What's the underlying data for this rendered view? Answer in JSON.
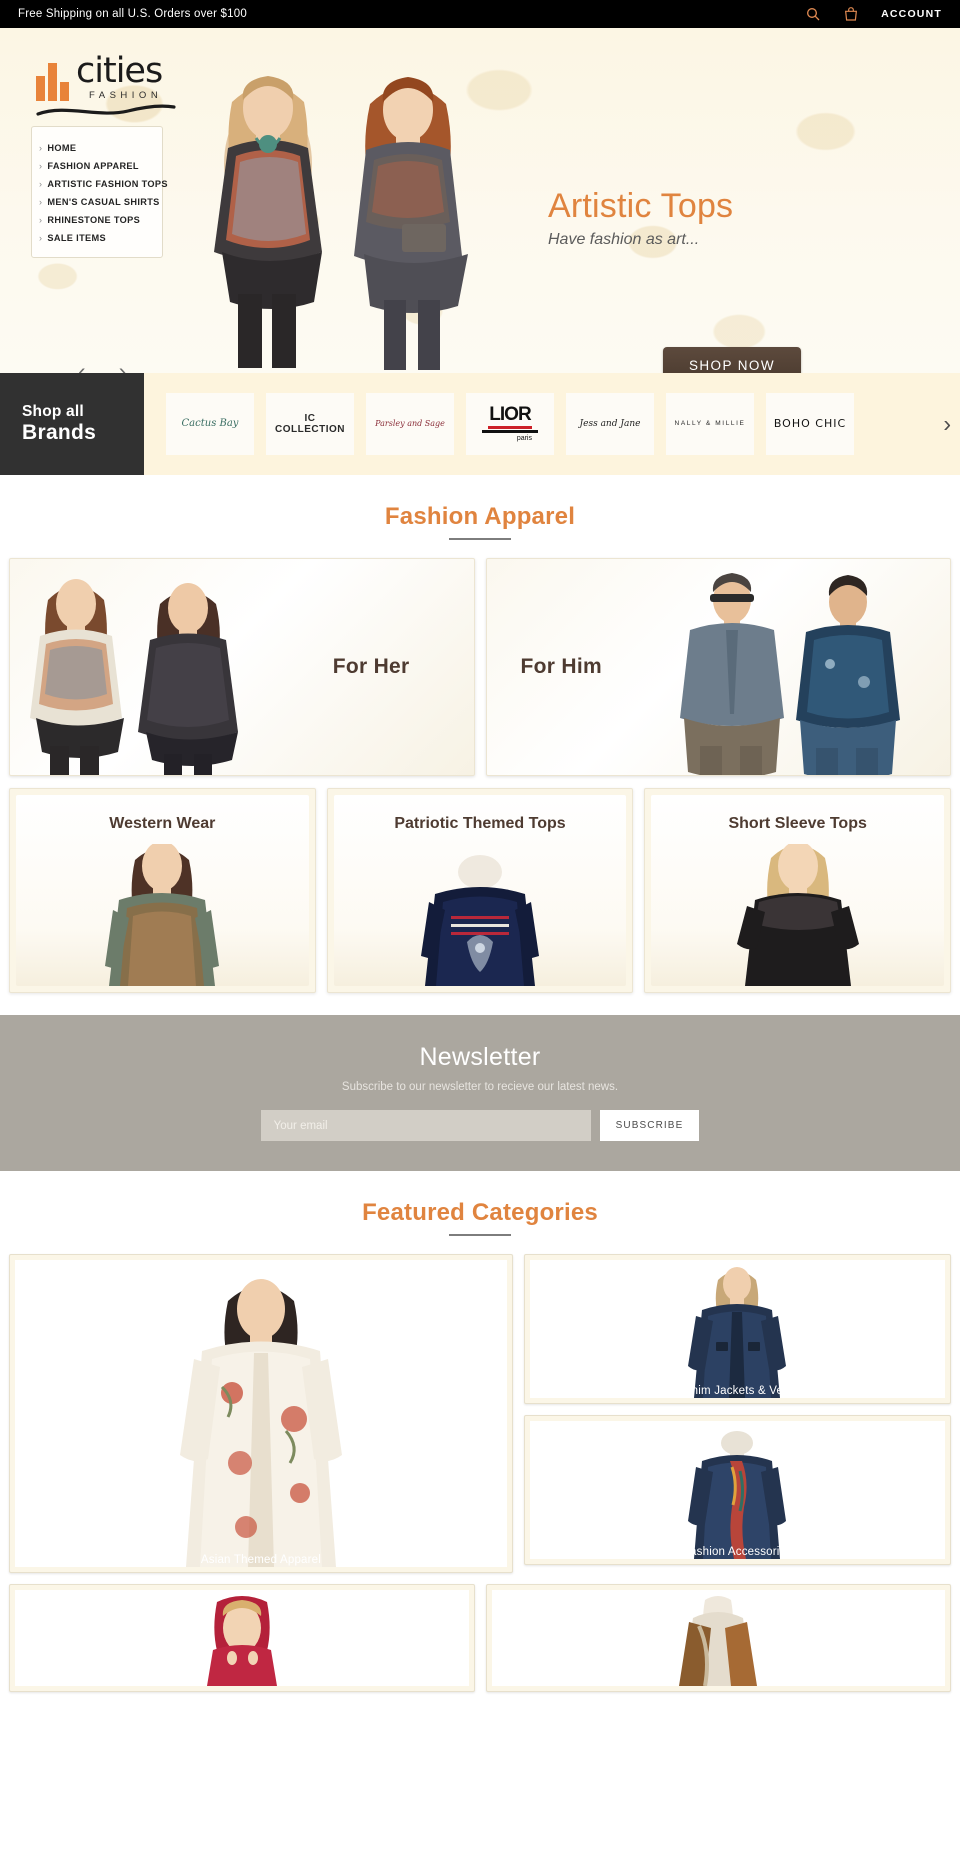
{
  "topbar": {
    "message": "Free Shipping on all U.S. Orders over $100",
    "search_icon": "search-icon",
    "bag_icon": "shopping-bag-icon",
    "account_label": "ACCOUNT"
  },
  "logo": {
    "name": "cities",
    "tagline": "FASHION"
  },
  "nav": {
    "items": [
      {
        "label": "HOME"
      },
      {
        "label": "FASHION APPAREL"
      },
      {
        "label": "ARTISTIC FASHION TOPS"
      },
      {
        "label": "MEN'S CASUAL SHIRTS"
      },
      {
        "label": "RHINESTONE TOPS"
      },
      {
        "label": "SALE ITEMS"
      }
    ]
  },
  "hero": {
    "title": "Artistic Tops",
    "subtitle": "Have fashion as art...",
    "cta_label": "SHOP NOW",
    "prev_icon": "chevron-left-icon",
    "next_icon": "chevron-right-icon"
  },
  "brands": {
    "label_line1": "Shop all",
    "label_line2": "Brands",
    "next_icon": "chevron-right-icon",
    "items": [
      {
        "name": "Cactus Bay"
      },
      {
        "name": "IC COLLECTION"
      },
      {
        "name": "Parsley and Sage"
      },
      {
        "name": "LIOR",
        "sub": "paris"
      },
      {
        "name": "Jess and Jane"
      },
      {
        "name": "NALLY & MILLIE"
      },
      {
        "name": "BOHO CHIC"
      }
    ]
  },
  "fashion_apparel": {
    "heading": "Fashion Apparel",
    "big_cards": [
      {
        "label": "For Her"
      },
      {
        "label": "For Him"
      }
    ],
    "tri_cards": [
      {
        "label": "Western Wear"
      },
      {
        "label": "Patriotic Themed Tops"
      },
      {
        "label": "Short Sleeve Tops"
      }
    ]
  },
  "newsletter": {
    "title": "Newsletter",
    "subtitle": "Subscribe to our newsletter to recieve our latest news.",
    "placeholder": "Your email",
    "button_label": "SUBSCRIBE"
  },
  "featured": {
    "heading": "Featured Categories",
    "cards": [
      {
        "label": "Asian Themed Apparel"
      },
      {
        "label": "Denim Jackets & Vests"
      },
      {
        "label": "Fashion Accessories"
      }
    ]
  },
  "colors": {
    "accent_orange": "#e0843f",
    "brand_brown": "#4e3b31",
    "cta_brown": "#4a3a2e",
    "newsletter_bg": "#aba79f",
    "cream": "#fdf4dd",
    "dark": "#313131"
  }
}
